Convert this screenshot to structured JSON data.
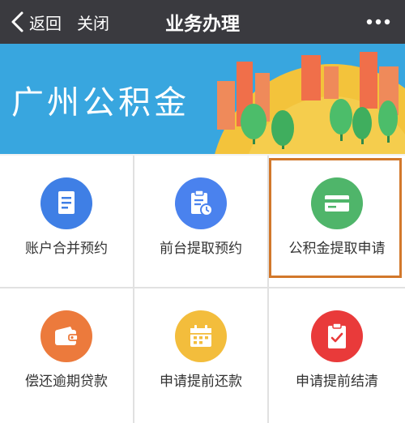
{
  "nav": {
    "back_label": "返回",
    "close_label": "关闭",
    "title": "业务办理",
    "more_icon": "more-dots-icon"
  },
  "banner": {
    "title": "广州公积金"
  },
  "services": [
    {
      "label": "账户合并预约",
      "icon": "document-icon",
      "color": "#3f7fe5"
    },
    {
      "label": "前台提取预约",
      "icon": "clipboard-clock-icon",
      "color": "#4a82ee"
    },
    {
      "label": "公积金提取申请",
      "icon": "card-icon",
      "color": "#4fb56a"
    },
    {
      "label": "偿还逾期贷款",
      "icon": "wallet-icon",
      "color": "#ec7a3c"
    },
    {
      "label": "申请提前还款",
      "icon": "calendar-icon",
      "color": "#f3bd3c"
    },
    {
      "label": "申请提前结清",
      "icon": "clipboard-check-icon",
      "color": "#e93a3a"
    }
  ],
  "colors": {
    "nav_bg": "#3a3a3f",
    "banner_blue": "#38a6df",
    "highlight_border": "#d2782b"
  }
}
